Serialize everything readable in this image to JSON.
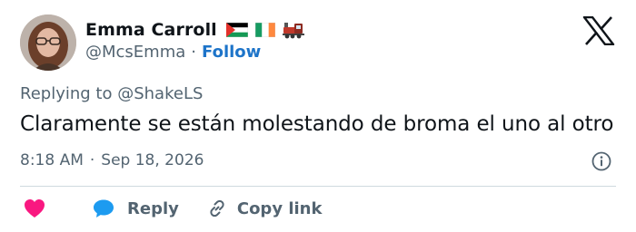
{
  "author": {
    "display_name": "Emma Carroll",
    "handle": "@McsEmma",
    "follow_label": "Follow",
    "flags": [
      "palestine-flag-icon",
      "ireland-flag-icon",
      "locomotive-icon"
    ]
  },
  "tweet": {
    "replying_prefix": "Replying to",
    "replying_to": "@ShakeLS",
    "text": "Claramente se están molestando de broma el uno al otro",
    "time": "8:18 AM",
    "date": "Sep 18, 2026"
  },
  "actions": {
    "reply_label": "Reply",
    "copy_link_label": "Copy link"
  },
  "colors": {
    "heart": "#f91880",
    "reply_bubble": "#1d9bf0",
    "follow": "#1d74c9",
    "muted": "#536471"
  },
  "icons": {
    "brand": "x-logo-icon",
    "info": "info-icon",
    "like": "heart-icon",
    "reply": "reply-bubble-icon",
    "copy": "link-icon"
  }
}
